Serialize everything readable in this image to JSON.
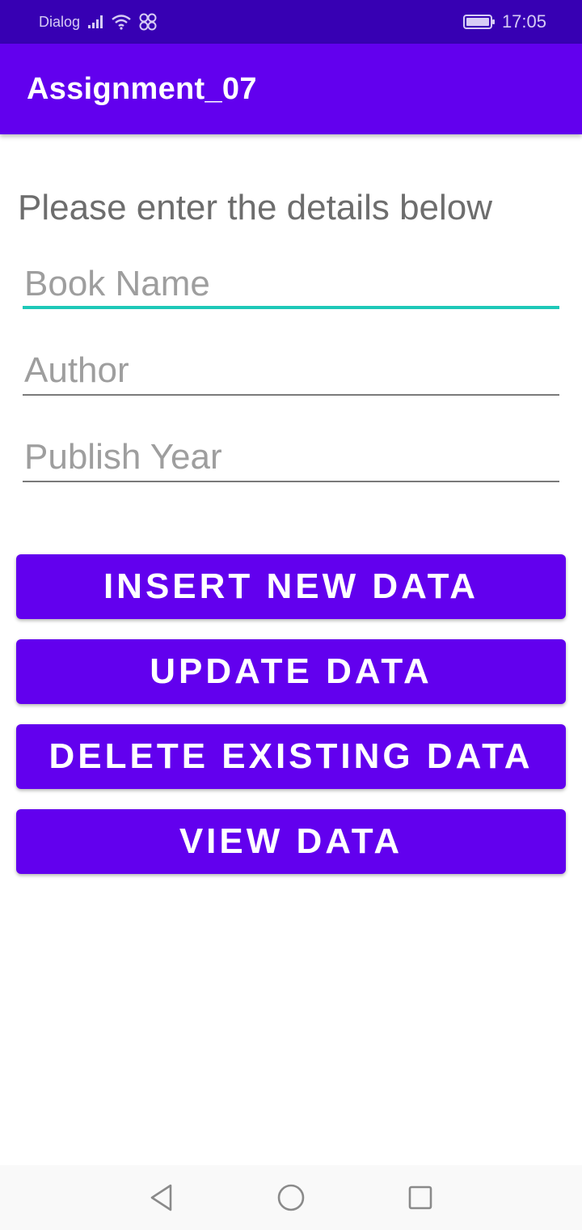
{
  "status_bar": {
    "carrier": "Dialog",
    "time": "17:05",
    "signal_icon": "signal-icon",
    "wifi_icon": "wifi-icon",
    "link_icon": "link-icon",
    "battery_icon": "battery-icon"
  },
  "app_bar": {
    "title": "Assignment_07"
  },
  "form": {
    "prompt": "Please enter the details below",
    "book_name": {
      "placeholder": "Book Name",
      "value": ""
    },
    "author": {
      "placeholder": "Author",
      "value": ""
    },
    "publish_year": {
      "placeholder": "Publish Year",
      "value": ""
    }
  },
  "buttons": {
    "insert": "INSERT NEW DATA",
    "update": "UPDATE DATA",
    "delete": "DELETE EXISTING DATA",
    "view": "VIEW DATA"
  },
  "colors": {
    "status_bar": "#3700b3",
    "primary": "#6200ee",
    "focus_underline": "#1ec8b8"
  },
  "nav": {
    "back_icon": "back-icon",
    "home_icon": "home-icon",
    "recents_icon": "recents-icon"
  }
}
